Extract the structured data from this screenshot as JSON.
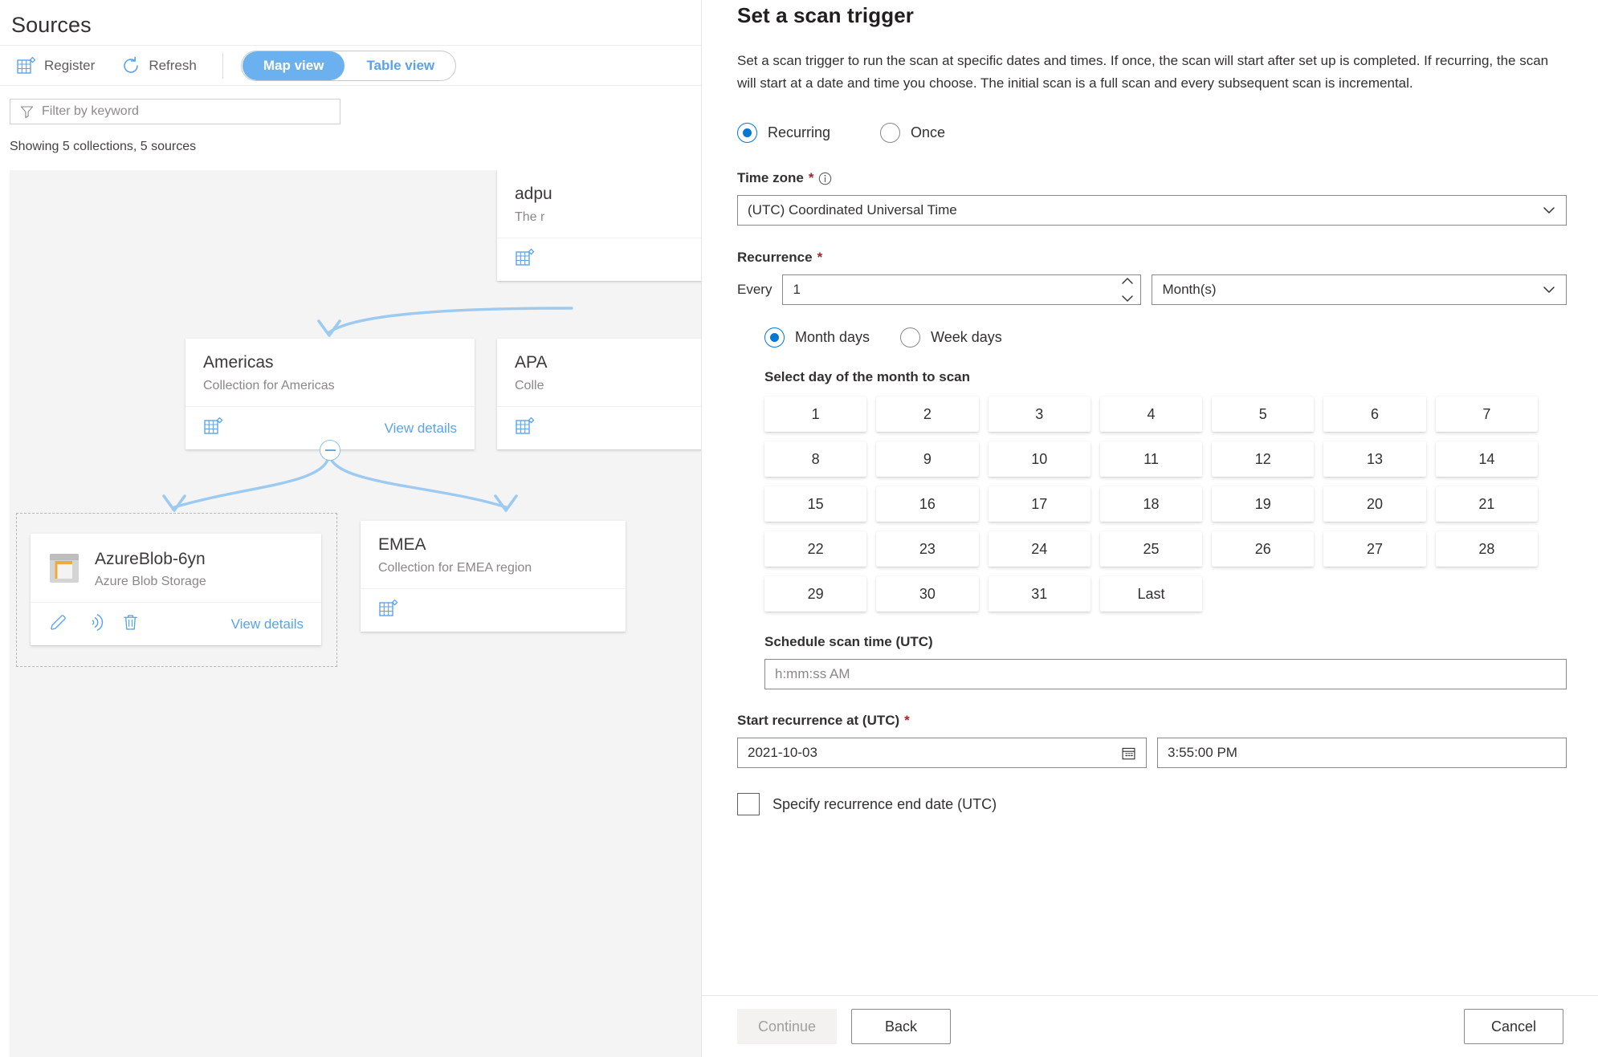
{
  "sources": {
    "title": "Sources",
    "toolbar": {
      "register_label": "Register",
      "register_icon": "register-grid-icon",
      "refresh_label": "Refresh",
      "refresh_icon": "refresh-icon",
      "map_view_label": "Map view",
      "table_view_label": "Table view",
      "active_view": "Map view"
    },
    "filter": {
      "placeholder": "Filter by keyword",
      "value": "",
      "icon": "filter-funnel-icon"
    },
    "status_text": "Showing 5 collections, 5 sources",
    "cards": [
      {
        "id": "adpurview",
        "title": "adpu",
        "subtitle": "The r",
        "footer_icon": "collection-icon",
        "view_details_label": ""
      },
      {
        "id": "americas",
        "title": "Americas",
        "subtitle": "Collection for Americas",
        "footer_icon": "collection-icon",
        "view_details_label": "View details"
      },
      {
        "id": "apac",
        "title": "APA",
        "subtitle": "Colle",
        "footer_icon": "collection-icon",
        "view_details_label": ""
      },
      {
        "id": "emea",
        "title": "EMEA",
        "subtitle": "Collection for EMEA region",
        "footer_icon": "collection-icon",
        "view_details_label": ""
      }
    ],
    "source_card": {
      "title": "AzureBlob-6yn",
      "subtitle": "Azure Blob Storage",
      "icon": "azure-blob-storage-icon",
      "actions": [
        {
          "name": "edit-icon",
          "label": "Edit"
        },
        {
          "name": "scan-icon",
          "label": "New scan"
        },
        {
          "name": "delete-icon",
          "label": "Delete"
        }
      ],
      "view_details_label": "View details"
    },
    "colors": {
      "accent": "#5ba3e6",
      "toggle_active_bg": "#6cb1ef",
      "connector": "#9ccaf0",
      "canvas_bg": "#f4f4f4"
    }
  },
  "panel": {
    "title": "Set a scan trigger",
    "description": "Set a scan trigger to run the scan at specific dates and times. If once, the scan will start after set up is completed. If recurring, the scan will start at a date and time you choose. The initial scan is a full scan and every subsequent scan is incremental.",
    "trigger_mode": {
      "selected": "Recurring",
      "options": [
        {
          "label": "Recurring",
          "selected": true
        },
        {
          "label": "Once",
          "selected": false
        }
      ]
    },
    "time_zone": {
      "label": "Time zone",
      "required": "*",
      "info_icon": "info-icon",
      "value": "(UTC) Coordinated Universal Time",
      "chevron_icon": "chevron-down-icon"
    },
    "recurrence": {
      "label": "Recurrence",
      "required": "*",
      "every_label": "Every",
      "interval_value": "1",
      "interval_spinner_up_icon": "chevron-up-icon",
      "interval_spinner_down_icon": "chevron-down-icon",
      "unit_value": "Month(s)",
      "unit_chevron_icon": "chevron-down-icon",
      "day_mode": {
        "selected": "Month days",
        "options": [
          {
            "label": "Month days",
            "selected": true
          },
          {
            "label": "Week days",
            "selected": false
          }
        ]
      },
      "day_picker_label": "Select day of the month to scan",
      "days": [
        "1",
        "2",
        "3",
        "4",
        "5",
        "6",
        "7",
        "8",
        "9",
        "10",
        "11",
        "12",
        "13",
        "14",
        "15",
        "16",
        "17",
        "18",
        "19",
        "20",
        "21",
        "22",
        "23",
        "24",
        "25",
        "26",
        "27",
        "28",
        "29",
        "30",
        "31",
        "Last"
      ],
      "selected_days": []
    },
    "schedule_scan_time": {
      "label": "Schedule scan time (UTC)",
      "placeholder": "h:mm:ss AM",
      "value": ""
    },
    "start_recurrence": {
      "label": "Start recurrence at (UTC)",
      "required": "*",
      "date_value": "2021-10-03",
      "date_icon": "calendar-icon",
      "time_value": "3:55:00 PM"
    },
    "end_date_checkbox": {
      "label": "Specify recurrence end date (UTC)",
      "checked": false
    },
    "footer": {
      "continue_label": "Continue",
      "continue_disabled": true,
      "back_label": "Back",
      "cancel_label": "Cancel"
    }
  }
}
